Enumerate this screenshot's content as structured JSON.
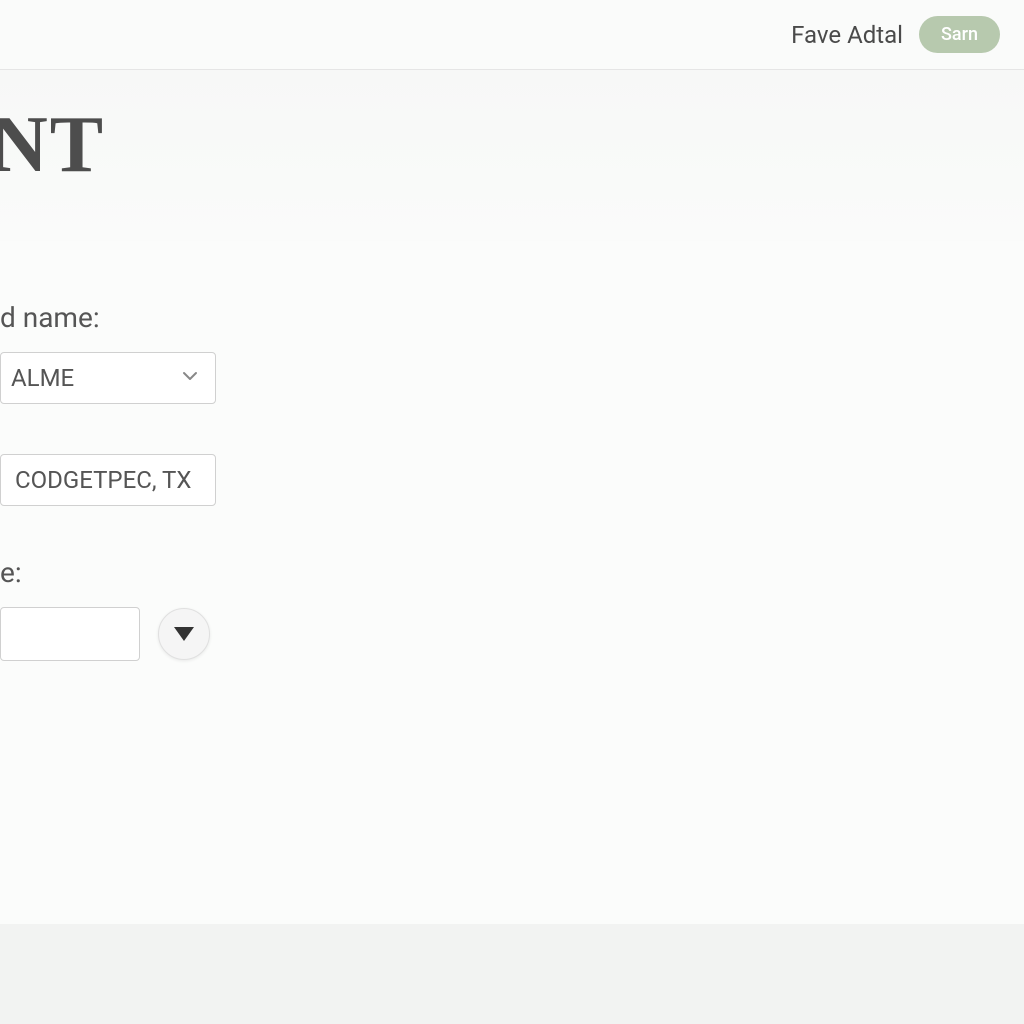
{
  "header": {
    "user_name": "Fave Adtal",
    "badge_label": "Sarn"
  },
  "title": {
    "text": "NT"
  },
  "form": {
    "field1": {
      "label_suffix": "d name:",
      "select_value": "ALME"
    },
    "field2": {
      "input_value": "CODGETPEC, TX"
    },
    "field3": {
      "label_suffix": "e:",
      "input_value": ""
    }
  }
}
